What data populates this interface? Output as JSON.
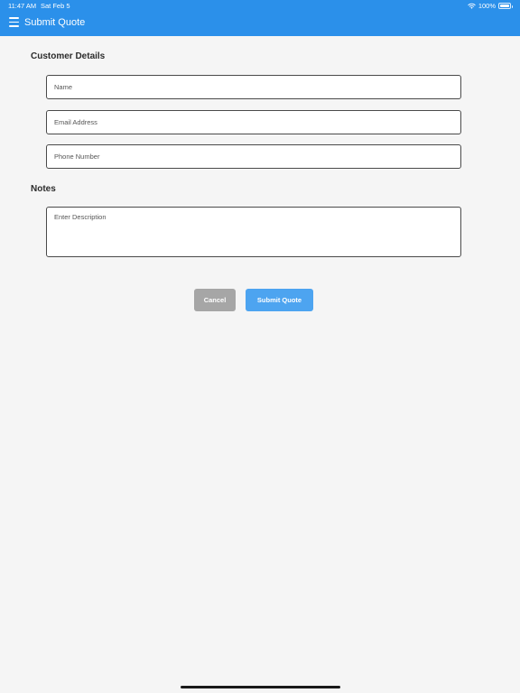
{
  "status_bar": {
    "time": "11:47 AM",
    "date": "Sat Feb 5",
    "battery": "100%",
    "battery_level": 1.0,
    "wifi_icon": "wifi-icon",
    "battery_icon": "battery-icon"
  },
  "header": {
    "title": "Submit Quote",
    "menu_icon": "hamburger-menu-icon",
    "background_color": "#2b90ea"
  },
  "customer_details": {
    "heading": "Customer Details",
    "name": {
      "placeholder": "Name",
      "value": ""
    },
    "email": {
      "placeholder": "Email Address",
      "value": ""
    },
    "phone": {
      "placeholder": "Phone Number",
      "value": ""
    }
  },
  "notes": {
    "heading": "Notes",
    "description": {
      "placeholder": "Enter Description",
      "value": ""
    }
  },
  "actions": {
    "cancel_label": "Cancel",
    "cancel_color": "#a6a6a6",
    "submit_label": "Submit Quote",
    "submit_color": "#4da4f0"
  }
}
